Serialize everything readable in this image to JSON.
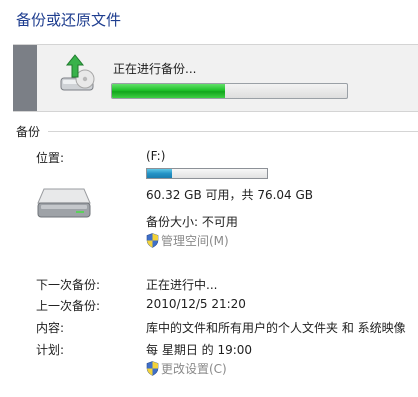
{
  "title": "备份或还原文件",
  "status": {
    "text": "正在进行备份...",
    "progress_percent": 48
  },
  "section_backup": "备份",
  "location": {
    "label": "位置:",
    "drive": "(F:)",
    "usage_percent": 21,
    "free_text": "60.32 GB 可用，共 76.04 GB",
    "backup_size": "备份大小: 不可用",
    "manage_space": "管理空间(M)"
  },
  "details": [
    {
      "label": "下一次备份:",
      "value": "正在进行中..."
    },
    {
      "label": "上一次备份:",
      "value": "2010/12/5 21:20"
    },
    {
      "label": "内容:",
      "value": "库中的文件和所有用户的个人文件夹 和 系统映像"
    },
    {
      "label": "计划:",
      "value": "每 星期日 的 19:00"
    }
  ],
  "change_settings": "更改设置(C)",
  "icons": {
    "status": "backup-drive-arrow-icon",
    "drive": "hard-drive-icon",
    "shield": "uac-shield-icon"
  },
  "colors": {
    "title": "#1e3d8f",
    "progress": "#1fc12a",
    "usage": "#2593c6"
  }
}
